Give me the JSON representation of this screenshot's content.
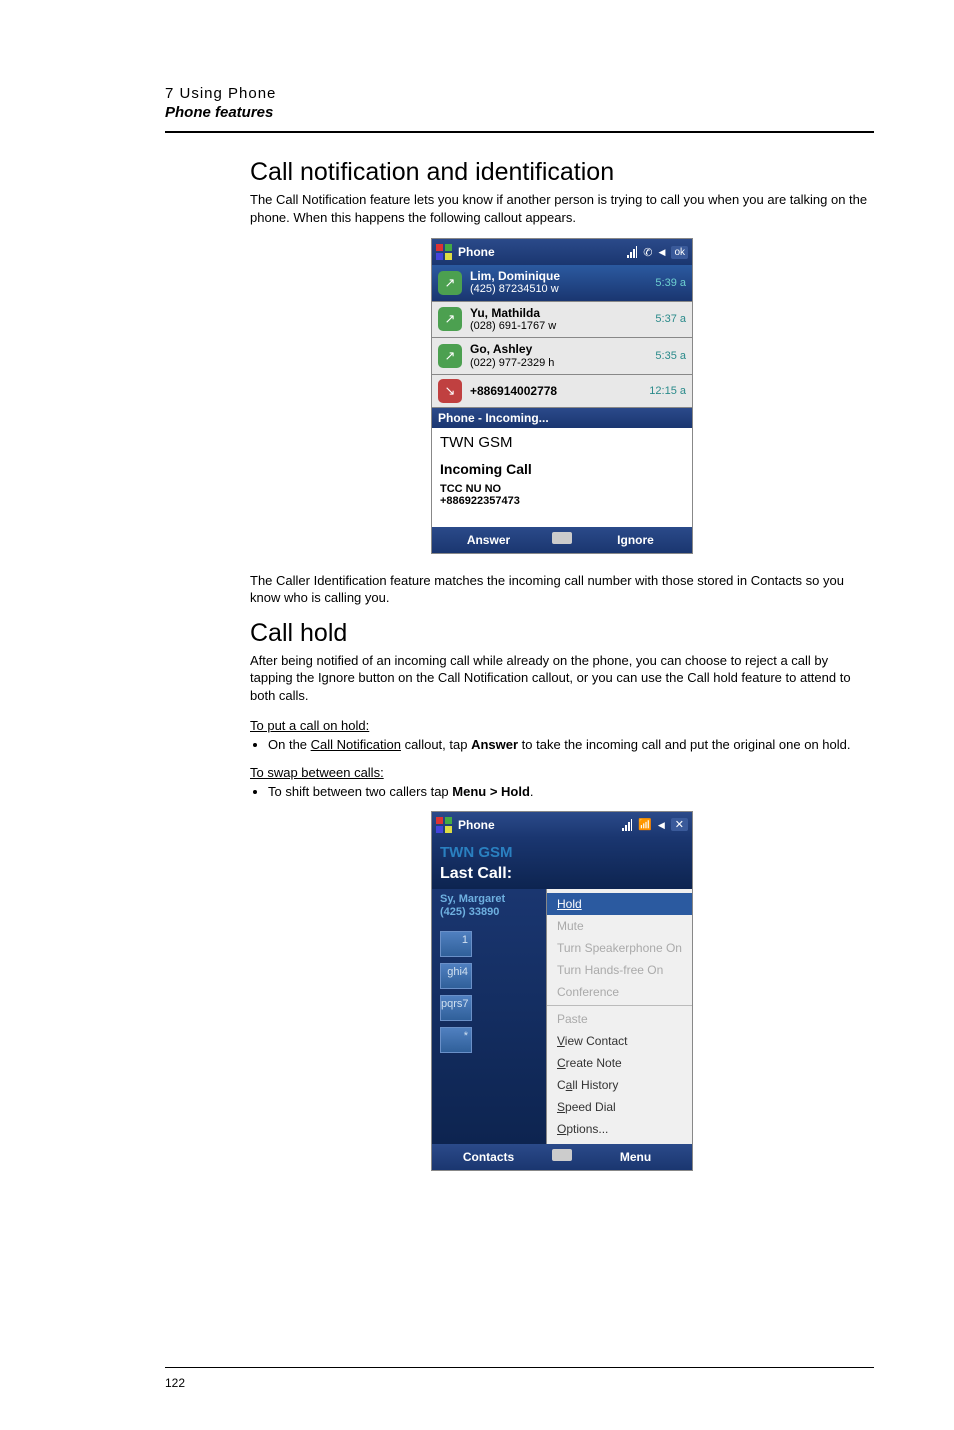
{
  "header": {
    "chapter": "7 Using Phone",
    "section": "Phone features"
  },
  "sec1": {
    "title": "Call notification and identification",
    "intro": "The Call Notification feature lets you know if another person is trying to call you when you are talking on the phone. When this happens the following callout appears.",
    "after": "The Caller Identification feature matches the incoming call number with those stored in Contacts so you know who is calling you."
  },
  "sec2": {
    "title": "Call hold",
    "intro": "After being notified of an incoming call while already on the phone, you can choose to reject a call by tapping the Ignore button on the Call Notification callout, or you can use the Call hold feature to attend to both calls.",
    "sub1": "To put a call on hold:",
    "bullet1_pre": "On the ",
    "bullet1_link": "Call Notification",
    "bullet1_mid": " callout, tap ",
    "bullet1_bold": "Answer",
    "bullet1_post": " to take the incoming call and put the original one on hold.",
    "sub2": "To swap between calls:",
    "bullet2_pre": "To shift between two callers tap ",
    "bullet2_bold": "Menu > Hold",
    "bullet2_post": "."
  },
  "shot1": {
    "title": "Phone",
    "ok": "ok",
    "rows": [
      {
        "name": "Lim, Dominique",
        "num": "(425) 87234510 w",
        "time": "5:39 a"
      },
      {
        "name": "Yu, Mathilda",
        "num": "(028) 691-1767 w",
        "time": "5:37 a"
      },
      {
        "name": "Go, Ashley",
        "num": "(022) 977-2329 h",
        "time": "5:35 a"
      },
      {
        "name": "+886914002778",
        "num": "",
        "time": "12:15 a"
      }
    ],
    "notif_header": "Phone - Incoming...",
    "carrier": "TWN GSM",
    "incoming": "Incoming Call",
    "caller": "TCC NU NO",
    "number": "+886922357473",
    "sk_left": "Answer",
    "sk_right": "Ignore"
  },
  "shot2": {
    "title": "Phone",
    "carrier": "TWN GSM",
    "lastcall": "Last Call:",
    "caller_name": "Sy, Margaret",
    "caller_num": "(425) 33890",
    "keys": [
      "1",
      "ghi4",
      "pqrs7",
      "*"
    ],
    "menu": {
      "hold": "Hold",
      "mute": "Mute",
      "spk": "Turn Speakerphone On",
      "hands": "Turn Hands-free On",
      "conf": "Conference",
      "paste": "Paste",
      "view": "View Contact",
      "create": "Create Note",
      "hist": "Call History",
      "speed": "Speed Dial",
      "opt": "Options..."
    },
    "sk_left": "Contacts",
    "sk_right": "Menu"
  },
  "page_number": "122"
}
